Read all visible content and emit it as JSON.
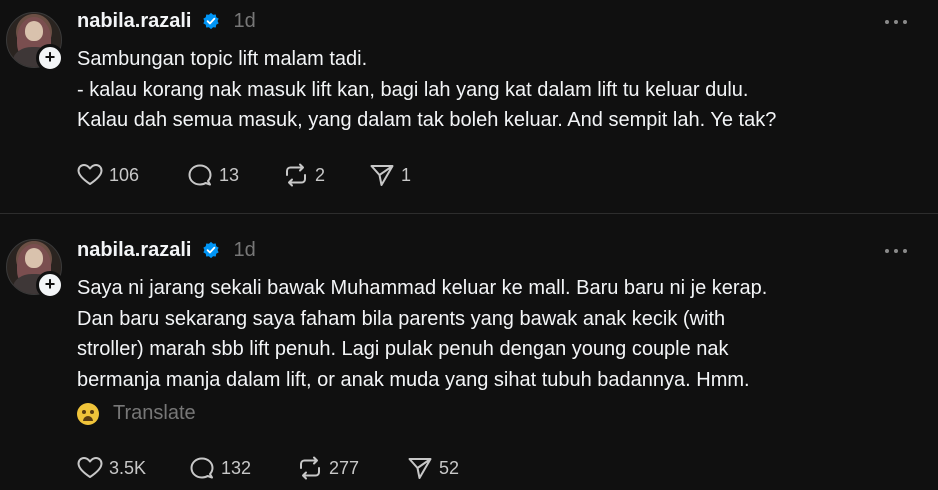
{
  "posts": [
    {
      "username": "nabila.razali",
      "time": "1d",
      "lines": [
        "Sambungan topic lift malam tadi.",
        "- kalau korang nak masuk lift kan, bagi lah yang kat dalam lift tu keluar dulu.",
        "Kalau dah semua masuk, yang dalam tak boleh keluar. And sempit lah. Ye tak?"
      ],
      "likes": "106",
      "comments": "13",
      "reposts": "2",
      "shares": "1"
    },
    {
      "username": "nabila.razali",
      "time": "1d",
      "lines": [
        "Saya ni jarang sekali bawak Muhammad keluar ke mall. Baru baru ni je kerap.",
        "Dan baru sekarang saya faham bila parents yang bawak anak kecik (with",
        "stroller) marah sbb lift penuh. Lagi pulak penuh dengan young couple nak",
        "bermanja manja dalam lift, or anak muda yang sihat tubuh badannya. Hmm."
      ],
      "translate_label": "Translate",
      "likes": "3.5K",
      "comments": "132",
      "reposts": "277",
      "shares": "52"
    }
  ],
  "icons": {
    "verified": "verified-badge-icon",
    "more": "more-options-icon",
    "like": "heart-icon",
    "comment": "comment-bubble-icon",
    "repost": "repost-icon",
    "share": "share-send-icon",
    "emoji": "weary-face-emoji"
  },
  "colors": {
    "background": "#101010",
    "text": "#f3f5f7",
    "muted": "#777777",
    "verified": "#0095f6",
    "divider": "#2d2d2d"
  }
}
